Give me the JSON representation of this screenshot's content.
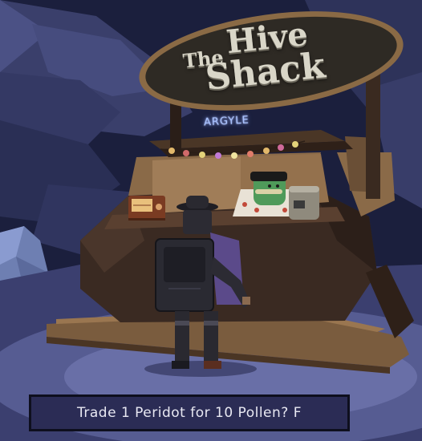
{
  "sign": {
    "the": "The",
    "hive": "Hive",
    "shack": "Shack"
  },
  "vendor_name": "ARGYLE",
  "dialog": {
    "text": "Trade 1 Peridot for 10 Pollen? F"
  },
  "colors": {
    "night_sky": "#1b1f3d",
    "sign_board": "#2e2a24",
    "sign_border": "#8a6a45",
    "wood_dark": "#3a2a22",
    "wood_light": "#8a6a48",
    "dialog_bg": "#2b2c55",
    "dialog_border": "#0e0f1e",
    "vendor_skin": "#4f9a5a",
    "neon": "#a9c2ff"
  }
}
